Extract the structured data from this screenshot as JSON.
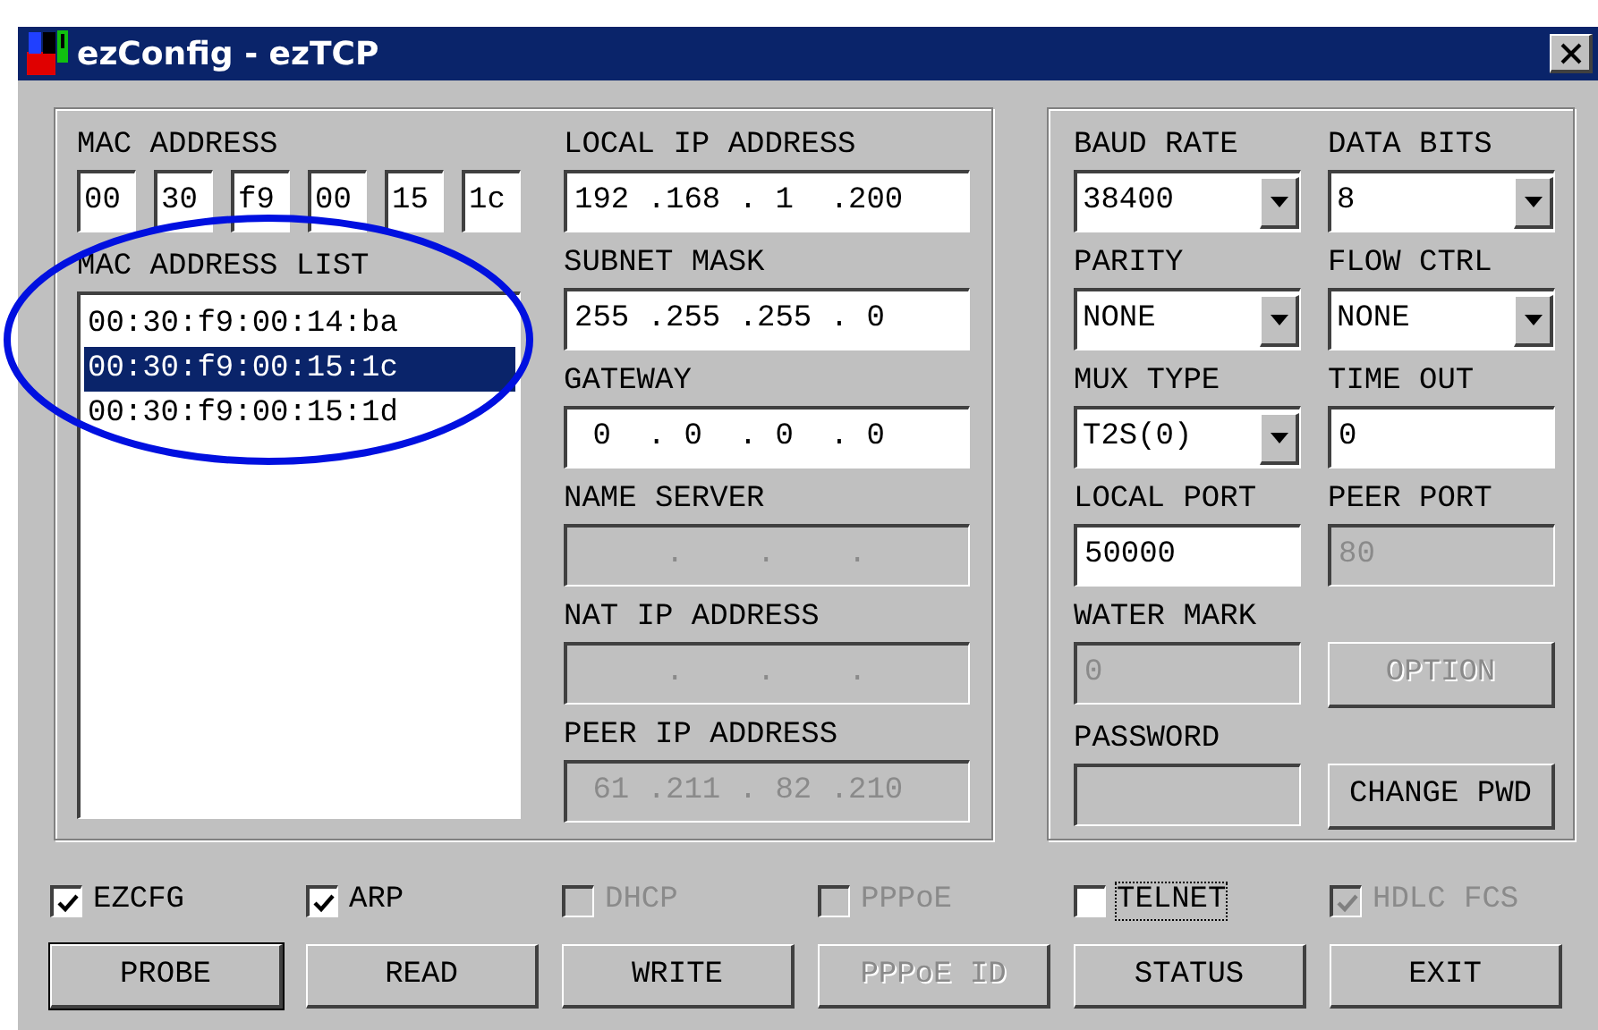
{
  "window": {
    "title": "ezConfig - ezTCP"
  },
  "mac_address": {
    "label": "MAC ADDRESS",
    "octets": [
      "00",
      "30",
      "f9",
      "00",
      "15",
      "1c"
    ]
  },
  "mac_list": {
    "label": "MAC ADDRESS LIST",
    "items": [
      {
        "text": "00:30:f9:00:14:ba",
        "selected": false
      },
      {
        "text": "00:30:f9:00:15:1c",
        "selected": true
      },
      {
        "text": "00:30:f9:00:15:1d",
        "selected": false
      }
    ]
  },
  "ip_fields": [
    {
      "label": "LOCAL IP ADDRESS",
      "value": "192 .168 . 1  .200",
      "disabled": false
    },
    {
      "label": "SUBNET MASK",
      "value": "255 .255 .255 . 0",
      "disabled": false
    },
    {
      "label": "GATEWAY",
      "value": " 0  . 0  . 0  . 0",
      "disabled": false
    },
    {
      "label": "NAME SERVER",
      "value": "     .    .    .",
      "disabled": true
    },
    {
      "label": "NAT IP ADDRESS",
      "value": "     .    .    .",
      "disabled": true
    },
    {
      "label": "PEER IP ADDRESS",
      "value": " 61 .211 . 82 .210",
      "disabled": true
    }
  ],
  "serial_settings": [
    {
      "kind": "select",
      "label": "BAUD RATE",
      "value": "38400",
      "disabled": false
    },
    {
      "kind": "select",
      "label": "DATA BITS",
      "value": "8",
      "disabled": false
    },
    {
      "kind": "select",
      "label": "PARITY",
      "value": "NONE",
      "disabled": false
    },
    {
      "kind": "select",
      "label": "FLOW CTRL",
      "value": "NONE",
      "disabled": false
    },
    {
      "kind": "select",
      "label": "MUX TYPE",
      "value": "T2S(0)",
      "disabled": false
    },
    {
      "kind": "input",
      "label": "TIME OUT",
      "value": "0",
      "disabled": false
    },
    {
      "kind": "input",
      "label": "LOCAL PORT",
      "value": "50000",
      "disabled": false
    },
    {
      "kind": "input",
      "label": "PEER PORT",
      "value": "80",
      "disabled": true
    },
    {
      "kind": "input",
      "label": "WATER MARK",
      "value": "0",
      "disabled": true
    },
    {
      "kind": "button",
      "value": "OPTION",
      "disabled": true
    },
    {
      "kind": "input",
      "label": "PASSWORD",
      "disabled": true
    },
    {
      "kind": "button",
      "value": "CHANGE PWD",
      "disabled": false
    }
  ],
  "options": [
    {
      "label": "EZCFG",
      "checked": true,
      "disabled": false,
      "focused": false
    },
    {
      "label": "ARP",
      "checked": true,
      "disabled": false,
      "focused": false
    },
    {
      "label": "DHCP",
      "checked": false,
      "disabled": true,
      "focused": false
    },
    {
      "label": "PPPoE",
      "checked": false,
      "disabled": true,
      "focused": false
    },
    {
      "label": "TELNET",
      "checked": false,
      "disabled": false,
      "focused": true
    },
    {
      "label": "HDLC FCS",
      "checked": true,
      "disabled": true,
      "focused": false
    }
  ],
  "buttons": [
    {
      "label": "PROBE",
      "disabled": false,
      "default": true
    },
    {
      "label": "READ",
      "disabled": false,
      "default": false
    },
    {
      "label": "WRITE",
      "disabled": false,
      "default": false
    },
    {
      "label": "PPPoE ID",
      "disabled": true,
      "default": false
    },
    {
      "label": "STATUS",
      "disabled": false,
      "default": false
    },
    {
      "label": "EXIT",
      "disabled": false,
      "default": false
    }
  ]
}
